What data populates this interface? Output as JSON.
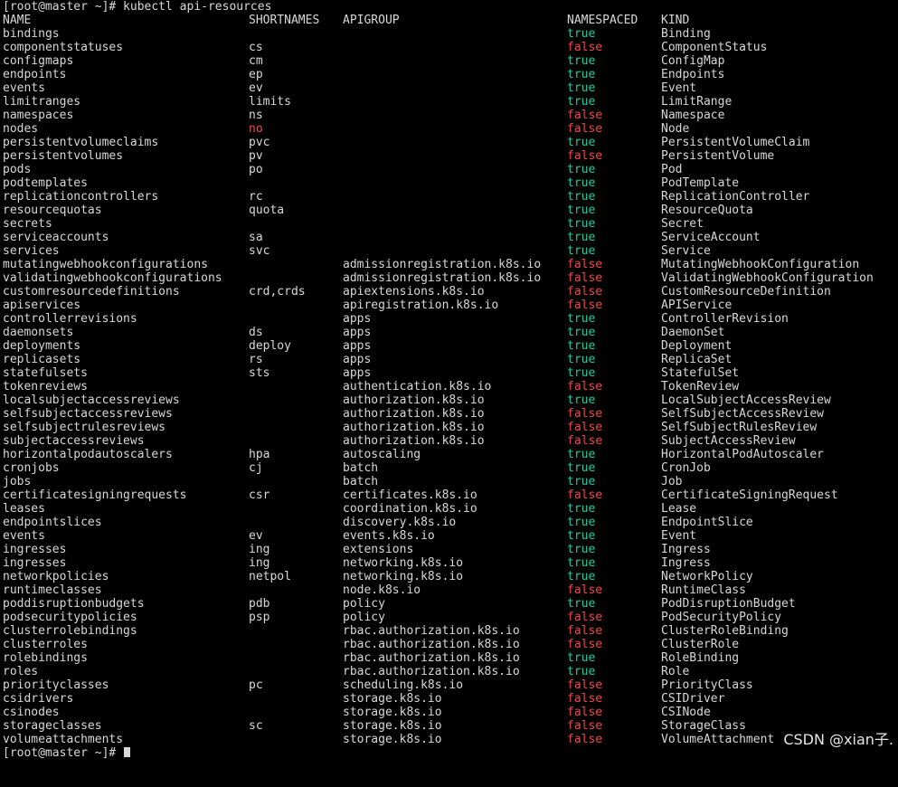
{
  "colors": {
    "background": "#000000",
    "text": "#d8d8d8",
    "true": "#22c8a0",
    "false": "#e84a4a"
  },
  "prompt": {
    "text": "[root@master ~]# kubectl api-resources"
  },
  "header": {
    "name": "NAME",
    "shortnames": "SHORTNAMES",
    "apigroup": "APIGROUP",
    "namespaced": "NAMESPACED",
    "kind": "KIND"
  },
  "rows": [
    {
      "name": "bindings",
      "shortnames": "",
      "apigroup": "",
      "namespaced": "true",
      "kind": "Binding"
    },
    {
      "name": "componentstatuses",
      "shortnames": "cs",
      "apigroup": "",
      "namespaced": "false",
      "kind": "ComponentStatus"
    },
    {
      "name": "configmaps",
      "shortnames": "cm",
      "apigroup": "",
      "namespaced": "true",
      "kind": "ConfigMap"
    },
    {
      "name": "endpoints",
      "shortnames": "ep",
      "apigroup": "",
      "namespaced": "true",
      "kind": "Endpoints"
    },
    {
      "name": "events",
      "shortnames": "ev",
      "apigroup": "",
      "namespaced": "true",
      "kind": "Event"
    },
    {
      "name": "limitranges",
      "shortnames": "limits",
      "apigroup": "",
      "namespaced": "true",
      "kind": "LimitRange"
    },
    {
      "name": "namespaces",
      "shortnames": "ns",
      "apigroup": "",
      "namespaced": "false",
      "kind": "Namespace"
    },
    {
      "name": "nodes",
      "shortnames": "no",
      "apigroup": "",
      "namespaced": "false",
      "kind": "Node",
      "short_color": "red"
    },
    {
      "name": "persistentvolumeclaims",
      "shortnames": "pvc",
      "apigroup": "",
      "namespaced": "true",
      "kind": "PersistentVolumeClaim"
    },
    {
      "name": "persistentvolumes",
      "shortnames": "pv",
      "apigroup": "",
      "namespaced": "false",
      "kind": "PersistentVolume"
    },
    {
      "name": "pods",
      "shortnames": "po",
      "apigroup": "",
      "namespaced": "true",
      "kind": "Pod"
    },
    {
      "name": "podtemplates",
      "shortnames": "",
      "apigroup": "",
      "namespaced": "true",
      "kind": "PodTemplate"
    },
    {
      "name": "replicationcontrollers",
      "shortnames": "rc",
      "apigroup": "",
      "namespaced": "true",
      "kind": "ReplicationController"
    },
    {
      "name": "resourcequotas",
      "shortnames": "quota",
      "apigroup": "",
      "namespaced": "true",
      "kind": "ResourceQuota"
    },
    {
      "name": "secrets",
      "shortnames": "",
      "apigroup": "",
      "namespaced": "true",
      "kind": "Secret"
    },
    {
      "name": "serviceaccounts",
      "shortnames": "sa",
      "apigroup": "",
      "namespaced": "true",
      "kind": "ServiceAccount"
    },
    {
      "name": "services",
      "shortnames": "svc",
      "apigroup": "",
      "namespaced": "true",
      "kind": "Service"
    },
    {
      "name": "mutatingwebhookconfigurations",
      "shortnames": "",
      "apigroup": "admissionregistration.k8s.io",
      "namespaced": "false",
      "kind": "MutatingWebhookConfiguration"
    },
    {
      "name": "validatingwebhookconfigurations",
      "shortnames": "",
      "apigroup": "admissionregistration.k8s.io",
      "namespaced": "false",
      "kind": "ValidatingWebhookConfiguration"
    },
    {
      "name": "customresourcedefinitions",
      "shortnames": "crd,crds",
      "apigroup": "apiextensions.k8s.io",
      "namespaced": "false",
      "kind": "CustomResourceDefinition"
    },
    {
      "name": "apiservices",
      "shortnames": "",
      "apigroup": "apiregistration.k8s.io",
      "namespaced": "false",
      "kind": "APIService"
    },
    {
      "name": "controllerrevisions",
      "shortnames": "",
      "apigroup": "apps",
      "namespaced": "true",
      "kind": "ControllerRevision"
    },
    {
      "name": "daemonsets",
      "shortnames": "ds",
      "apigroup": "apps",
      "namespaced": "true",
      "kind": "DaemonSet"
    },
    {
      "name": "deployments",
      "shortnames": "deploy",
      "apigroup": "apps",
      "namespaced": "true",
      "kind": "Deployment"
    },
    {
      "name": "replicasets",
      "shortnames": "rs",
      "apigroup": "apps",
      "namespaced": "true",
      "kind": "ReplicaSet"
    },
    {
      "name": "statefulsets",
      "shortnames": "sts",
      "apigroup": "apps",
      "namespaced": "true",
      "kind": "StatefulSet"
    },
    {
      "name": "tokenreviews",
      "shortnames": "",
      "apigroup": "authentication.k8s.io",
      "namespaced": "false",
      "kind": "TokenReview"
    },
    {
      "name": "localsubjectaccessreviews",
      "shortnames": "",
      "apigroup": "authorization.k8s.io",
      "namespaced": "true",
      "kind": "LocalSubjectAccessReview"
    },
    {
      "name": "selfsubjectaccessreviews",
      "shortnames": "",
      "apigroup": "authorization.k8s.io",
      "namespaced": "false",
      "kind": "SelfSubjectAccessReview"
    },
    {
      "name": "selfsubjectrulesreviews",
      "shortnames": "",
      "apigroup": "authorization.k8s.io",
      "namespaced": "false",
      "kind": "SelfSubjectRulesReview"
    },
    {
      "name": "subjectaccessreviews",
      "shortnames": "",
      "apigroup": "authorization.k8s.io",
      "namespaced": "false",
      "kind": "SubjectAccessReview"
    },
    {
      "name": "horizontalpodautoscalers",
      "shortnames": "hpa",
      "apigroup": "autoscaling",
      "namespaced": "true",
      "kind": "HorizontalPodAutoscaler"
    },
    {
      "name": "cronjobs",
      "shortnames": "cj",
      "apigroup": "batch",
      "namespaced": "true",
      "kind": "CronJob"
    },
    {
      "name": "jobs",
      "shortnames": "",
      "apigroup": "batch",
      "namespaced": "true",
      "kind": "Job"
    },
    {
      "name": "certificatesigningrequests",
      "shortnames": "csr",
      "apigroup": "certificates.k8s.io",
      "namespaced": "false",
      "kind": "CertificateSigningRequest"
    },
    {
      "name": "leases",
      "shortnames": "",
      "apigroup": "coordination.k8s.io",
      "namespaced": "true",
      "kind": "Lease"
    },
    {
      "name": "endpointslices",
      "shortnames": "",
      "apigroup": "discovery.k8s.io",
      "namespaced": "true",
      "kind": "EndpointSlice"
    },
    {
      "name": "events",
      "shortnames": "ev",
      "apigroup": "events.k8s.io",
      "namespaced": "true",
      "kind": "Event"
    },
    {
      "name": "ingresses",
      "shortnames": "ing",
      "apigroup": "extensions",
      "namespaced": "true",
      "kind": "Ingress"
    },
    {
      "name": "ingresses",
      "shortnames": "ing",
      "apigroup": "networking.k8s.io",
      "namespaced": "true",
      "kind": "Ingress"
    },
    {
      "name": "networkpolicies",
      "shortnames": "netpol",
      "apigroup": "networking.k8s.io",
      "namespaced": "true",
      "kind": "NetworkPolicy"
    },
    {
      "name": "runtimeclasses",
      "shortnames": "",
      "apigroup": "node.k8s.io",
      "namespaced": "false",
      "kind": "RuntimeClass"
    },
    {
      "name": "poddisruptionbudgets",
      "shortnames": "pdb",
      "apigroup": "policy",
      "namespaced": "true",
      "kind": "PodDisruptionBudget"
    },
    {
      "name": "podsecuritypolicies",
      "shortnames": "psp",
      "apigroup": "policy",
      "namespaced": "false",
      "kind": "PodSecurityPolicy"
    },
    {
      "name": "clusterrolebindings",
      "shortnames": "",
      "apigroup": "rbac.authorization.k8s.io",
      "namespaced": "false",
      "kind": "ClusterRoleBinding"
    },
    {
      "name": "clusterroles",
      "shortnames": "",
      "apigroup": "rbac.authorization.k8s.io",
      "namespaced": "false",
      "kind": "ClusterRole"
    },
    {
      "name": "rolebindings",
      "shortnames": "",
      "apigroup": "rbac.authorization.k8s.io",
      "namespaced": "true",
      "kind": "RoleBinding"
    },
    {
      "name": "roles",
      "shortnames": "",
      "apigroup": "rbac.authorization.k8s.io",
      "namespaced": "true",
      "kind": "Role"
    },
    {
      "name": "priorityclasses",
      "shortnames": "pc",
      "apigroup": "scheduling.k8s.io",
      "namespaced": "false",
      "kind": "PriorityClass"
    },
    {
      "name": "csidrivers",
      "shortnames": "",
      "apigroup": "storage.k8s.io",
      "namespaced": "false",
      "kind": "CSIDriver"
    },
    {
      "name": "csinodes",
      "shortnames": "",
      "apigroup": "storage.k8s.io",
      "namespaced": "false",
      "kind": "CSINode"
    },
    {
      "name": "storageclasses",
      "shortnames": "sc",
      "apigroup": "storage.k8s.io",
      "namespaced": "false",
      "kind": "StorageClass"
    },
    {
      "name": "volumeattachments",
      "shortnames": "",
      "apigroup": "storage.k8s.io",
      "namespaced": "false",
      "kind": "VolumeAttachment"
    }
  ],
  "final_prompt": {
    "text": "[root@master ~]# "
  },
  "watermark": {
    "text": "CSDN @xian子."
  }
}
